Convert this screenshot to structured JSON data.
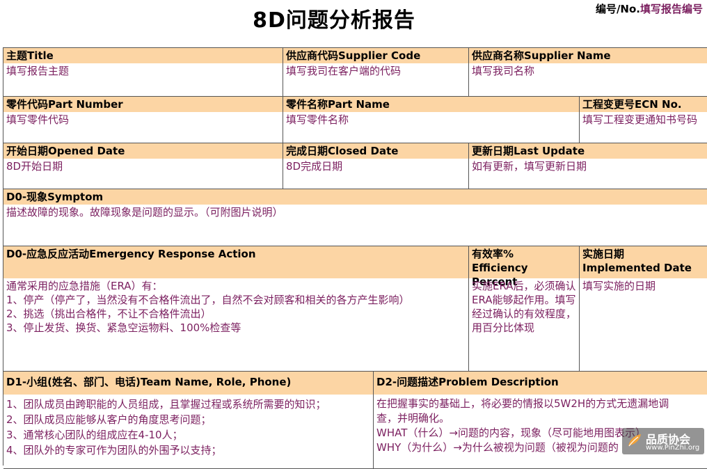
{
  "title": "8D问题分析报告",
  "number": {
    "label": "编号/No.",
    "value": "填写报告编号"
  },
  "row1": {
    "topic": {
      "header": "主题Title",
      "value": "填写报告主题"
    },
    "supplier_code": {
      "header": "供应商代码Supplier Code",
      "value": "填写我司在客户端的代码"
    },
    "supplier_name": {
      "header": "供应商名称Supplier Name",
      "value": "填写我司名称"
    }
  },
  "row2": {
    "part_number": {
      "header": "零件代码Part Number",
      "value": "填写零件代码"
    },
    "part_name": {
      "header": "零件名称Part Name",
      "value": "填写零件名称"
    },
    "ecn": {
      "header": "工程变更号ECN No.",
      "value": "填写工程变更通知书号码"
    }
  },
  "row3": {
    "opened": {
      "header": "开始日期Opened Date",
      "value": "8D开始日期"
    },
    "closed": {
      "header": "完成日期Closed Date",
      "value": "8D完成日期"
    },
    "updated": {
      "header": "更新日期Last Update",
      "value": "如有更新，填写更新日期"
    }
  },
  "symptom": {
    "header": "D0-现象Symptom",
    "value": "描述故障的现象。故障现象是问题的显示。（可附图片说明）"
  },
  "era": {
    "header": "D0-应急反应活动Emergency Response Action",
    "lines": [
      "通常采用的应急措施（ERA）有：",
      "1、停产（停产了，当然没有不合格件流出了，自然不会对顾客和相关的各方产生影响）",
      "2、挑选（挑出合格件，不让不合格件流出）",
      "3、停止发货、换货、紧急空运物料、100%检查等"
    ],
    "efficiency_header_1": "有效率%",
    "efficiency_header_2": "Efficiency Percent",
    "efficiency_value": "实施ERA后，必须确认ERA能够起作用。填写经过确认的有效程度，用百分比体现",
    "implemented_header_1": "实施日期",
    "implemented_header_2": "Implemented Date",
    "implemented_value": "填写实施的日期"
  },
  "d1": {
    "header": "D1-小组(姓名、部门、电话)Team Name, Role, Phone)",
    "lines": [
      "1、团队成员由跨职能的人员组成，且掌握过程或系统所需要的知识；",
      "2、团队成员应能够从客户的角度思考问题；",
      "3、通常核心团队的组成应在4-10人；",
      "4、团队外的专家可作为团队的外围予以支持；"
    ]
  },
  "d2": {
    "header": "D2-问题描述Problem Description",
    "lines": [
      "在把握事实的基础上，将必要的情报以5W2H的方式无遗漏地调",
      "查，并明确化。",
      "WHAT（什么）→问题的内容，现象（尽可能地用图表示）",
      "WHY（为什么）→为什么被视为问题（被视为问题的"
    ]
  },
  "watermark": {
    "main": "品质协会",
    "sub": "www.PinZhi.org"
  },
  "colors": {
    "header_bg": "#fcd5a4",
    "value_text": "#7b1f5f",
    "border": "#555555"
  }
}
